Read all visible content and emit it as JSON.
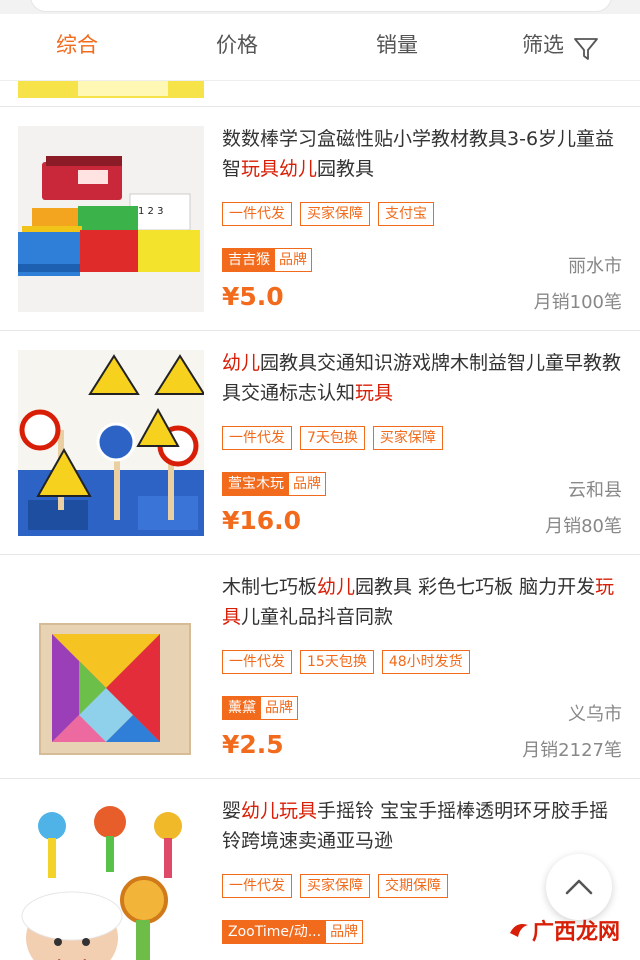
{
  "sort_tabs": [
    {
      "label": "综合",
      "active": true
    },
    {
      "label": "价格"
    },
    {
      "label": "销量"
    },
    {
      "label": "筛选"
    }
  ],
  "icons": {
    "filter": "filter-funnel-icon",
    "back_to_top": "chevron-up-icon"
  },
  "colors": {
    "accent": "#f26a1b",
    "highlight": "#d81e06"
  },
  "products": [
    {
      "title_parts": [
        {
          "text": "数数棒学习盒磁性贴小学教材教具3-6岁儿童益智"
        },
        {
          "text": "玩具幼儿",
          "hl": true
        },
        {
          "text": "园教具"
        }
      ],
      "tags": [
        "一件代发",
        "买家保障",
        "支付宝"
      ],
      "brand": "吉吉猴",
      "brand_label": "品牌",
      "location": "丽水市",
      "price": "¥5.0",
      "sales": "月销100笔"
    },
    {
      "title_parts": [
        {
          "text": "幼儿",
          "hl": true
        },
        {
          "text": "园教具交通知识游戏牌木制益智儿童早教教具交通标志认知"
        },
        {
          "text": "玩具",
          "hl": true
        }
      ],
      "tags": [
        "一件代发",
        "7天包换",
        "买家保障"
      ],
      "brand": "萱宝木玩",
      "brand_label": "品牌",
      "location": "云和县",
      "price": "¥16.0",
      "sales": "月销80笔"
    },
    {
      "title_parts": [
        {
          "text": "木制七巧板"
        },
        {
          "text": "幼儿",
          "hl": true
        },
        {
          "text": "园教具 彩色七巧板 脑力开发"
        },
        {
          "text": "玩具",
          "hl": true
        },
        {
          "text": "儿童礼品抖音同款"
        }
      ],
      "tags": [
        "一件代发",
        "15天包换",
        "48小时发货"
      ],
      "brand": "薰黛",
      "brand_label": "品牌",
      "location": "义乌市",
      "price": "¥2.5",
      "sales": "月销2127笔"
    },
    {
      "title_parts": [
        {
          "text": "婴"
        },
        {
          "text": "幼儿玩具",
          "hl": true
        },
        {
          "text": "手摇铃 宝宝手摇棒透明环牙胶手摇铃跨境速卖通亚马逊"
        }
      ],
      "tags": [
        "一件代发",
        "买家保障",
        "交期保障"
      ],
      "brand": "ZooTime/动...",
      "brand_label": "品牌",
      "location": "",
      "price": "",
      "sales": ""
    }
  ],
  "watermark": "广西龙网"
}
